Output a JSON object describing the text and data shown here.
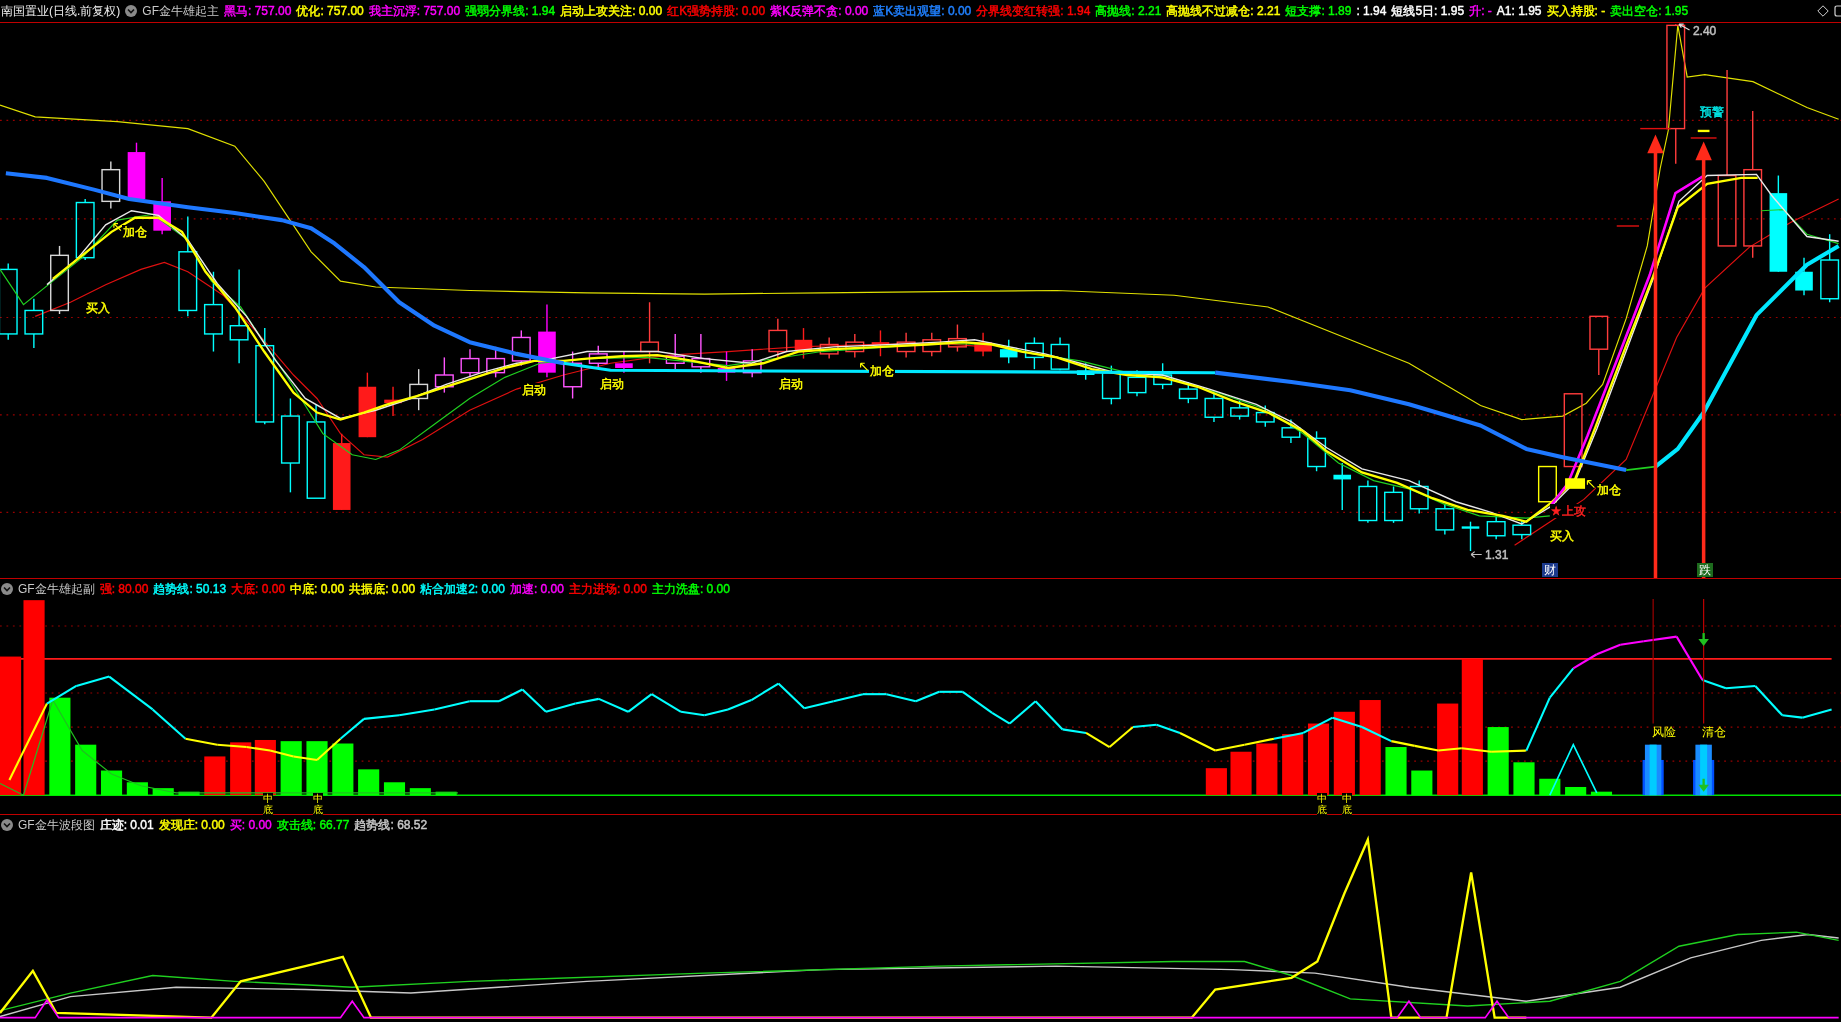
{
  "main_panel": {
    "header": {
      "stock": "南国置业(日线.前复权)",
      "indicator": "GF金牛雄起主",
      "readouts": [
        {
          "text": "黑马: 757.00",
          "color": "#ff00ff"
        },
        {
          "text": "优化: 757.00",
          "color": "#ffff00"
        },
        {
          "text": "我主沉浮: 757.00",
          "color": "#ff00ff"
        },
        {
          "text": "强弱分界线: 1.94",
          "color": "#00ff00"
        },
        {
          "text": "启动上攻关注: 0.00",
          "color": "#ffff00"
        },
        {
          "text": "红K强势持股: 0.00",
          "color": "#ff0000"
        },
        {
          "text": "紫K反弹不贪: 0.00",
          "color": "#ff00ff"
        },
        {
          "text": "蓝K卖出观望: 0.00",
          "color": "#2080ff"
        },
        {
          "text": "分界线变红转强: 1.94",
          "color": "#ff0000"
        },
        {
          "text": "高抛线: 2.21",
          "color": "#00ff00"
        },
        {
          "text": "高抛线不过减仓: 2.21",
          "color": "#ffff00"
        },
        {
          "text": "短支撑: 1.89",
          "color": "#00ff00"
        },
        {
          "text": ": 1.94",
          "color": "#ffffff"
        },
        {
          "text": "短线5日: 1.95",
          "color": "#ffffff"
        },
        {
          "text": "升: -",
          "color": "#ff00ff"
        },
        {
          "text": "A1: 1.95",
          "color": "#ffffff"
        },
        {
          "text": "买入持股: -",
          "color": "#ffff00"
        },
        {
          "text": "卖出空仓: 1.95",
          "color": "#00ff00"
        }
      ]
    },
    "labels": [
      {
        "text": "加仓",
        "color": "#ffff00"
      },
      {
        "text": "买入",
        "color": "#ffff00"
      },
      {
        "text": "启动",
        "color": "#ffff00"
      },
      {
        "text": "启动",
        "color": "#ffff00"
      },
      {
        "text": "启动",
        "color": "#ffff00"
      },
      {
        "text": "加仓",
        "color": "#ffff00"
      },
      {
        "text": "1.31",
        "color": "#c0c0c0"
      },
      {
        "text": "2.40",
        "color": "#c0c0c0"
      },
      {
        "text": "预警",
        "color": "#00e0e0"
      },
      {
        "text": "加仓",
        "color": "#ffff00"
      },
      {
        "text": "★上攻",
        "color": "#ff2020"
      },
      {
        "text": "买入",
        "color": "#ffff00"
      }
    ],
    "badges": [
      {
        "text": "财",
        "color": "#1c3a8c"
      },
      {
        "text": "跌",
        "color": "#1d6b1d"
      }
    ]
  },
  "sub_panel": {
    "header": {
      "indicator": "GF金牛雄起副",
      "readouts": [
        {
          "text": "强: 80.00",
          "color": "#ff0000"
        },
        {
          "text": "趋势线: 50.13",
          "color": "#00ffff"
        },
        {
          "text": "大底: 0.00",
          "color": "#ff0000"
        },
        {
          "text": "中底: 0.00",
          "color": "#ffff00"
        },
        {
          "text": "共振底: 0.00",
          "color": "#ffff00"
        },
        {
          "text": "粘合加速2: 0.00",
          "color": "#00ffff"
        },
        {
          "text": "加速: 0.00",
          "color": "#ff00ff"
        },
        {
          "text": "主力进场: 0.00",
          "color": "#ff0000"
        },
        {
          "text": "主力洗盘: 0.00",
          "color": "#00ff00"
        }
      ]
    },
    "labels": [
      {
        "text": "中底",
        "kind": "vertical"
      },
      {
        "text": "中底",
        "kind": "vertical"
      },
      {
        "text": "中底",
        "kind": "vertical"
      },
      {
        "text": "中底",
        "kind": "vertical"
      },
      {
        "text": "风险",
        "kind": "horizontal"
      },
      {
        "text": "清仓",
        "kind": "horizontal"
      }
    ]
  },
  "wave_panel": {
    "header": {
      "indicator": "GF金牛波段图",
      "readouts": [
        {
          "text": "庄迹: 0.01",
          "color": "#ffffff"
        },
        {
          "text": "发现庄: 0.00",
          "color": "#ffff00"
        },
        {
          "text": "买: 0.00",
          "color": "#ff00ff"
        },
        {
          "text": "攻击线: 66.77",
          "color": "#00ff00"
        },
        {
          "text": "趋势线: 68.52",
          "color": "#c8c8c8"
        }
      ]
    }
  }
}
